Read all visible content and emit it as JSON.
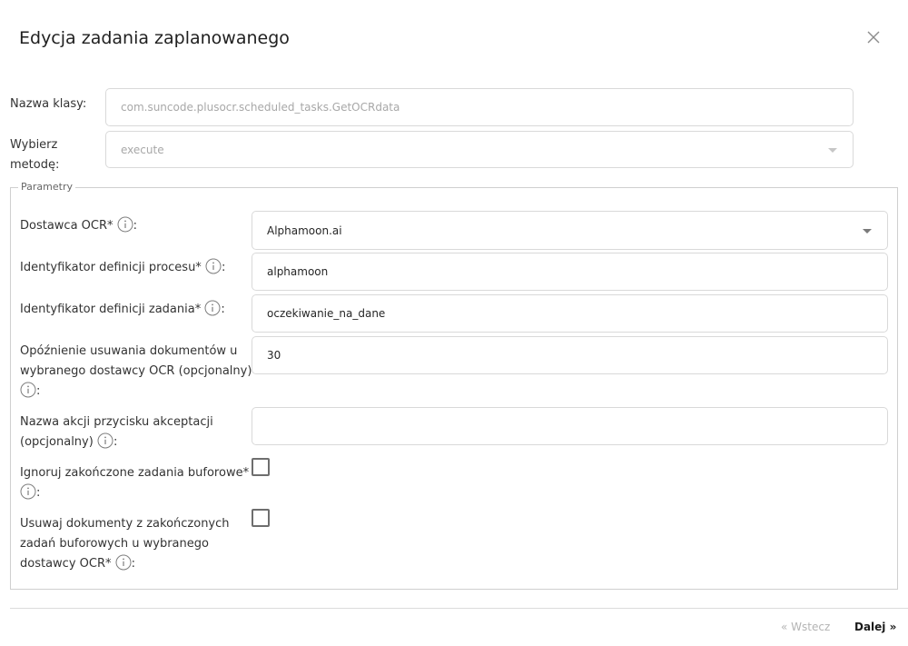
{
  "dialog": {
    "title": "Edycja zadania zaplanowanego"
  },
  "form": {
    "class_name": {
      "label": "Nazwa klasy:",
      "value": "com.suncode.plusocr.scheduled_tasks.GetOCRdata"
    },
    "method": {
      "label_line1": "Wybierz",
      "label_line2": "metodę:",
      "value": "execute"
    }
  },
  "parameters": {
    "legend": "Parametry",
    "ocr_provider": {
      "label": "Dostawca OCR*",
      "suffix": ":",
      "value": "Alphamoon.ai"
    },
    "process_definition_id": {
      "label": "Identyfikator definicji procesu*",
      "suffix": ":",
      "value": "alphamoon"
    },
    "task_definition_id": {
      "label": "Identyfikator definicji zadania*",
      "suffix": ":",
      "value": "oczekiwanie_na_dane"
    },
    "delete_delay": {
      "label_line1": "Opóźnienie usuwania dokumentów u",
      "label_line2": "wybranego dostawcy OCR (opcjonalny)",
      "suffix": ":",
      "value": "30"
    },
    "accept_action_name": {
      "label_line1": "Nazwa akcji przycisku akceptacji",
      "label_line2": "(opcjonalny)",
      "suffix": ":",
      "value": ""
    },
    "ignore_finished": {
      "label": "Ignoruj zakończone zadania buforowe*",
      "suffix": ":"
    },
    "delete_documents": {
      "label_line1": "Usuwaj dokumenty z zakończonych",
      "label_line2": "zadań buforowych u wybranego",
      "label_line3": "dostawcy OCR*",
      "suffix": ":"
    }
  },
  "footer": {
    "back_label": "« Wstecz",
    "next_label": "Dalej »"
  },
  "icons": {
    "close": "close-icon",
    "info": "info-icon",
    "dropdown": "chevron-down-icon"
  },
  "colors": {
    "border": "#d9d9d9",
    "disabled_text": "#a8a8a8",
    "text": "#262626"
  }
}
